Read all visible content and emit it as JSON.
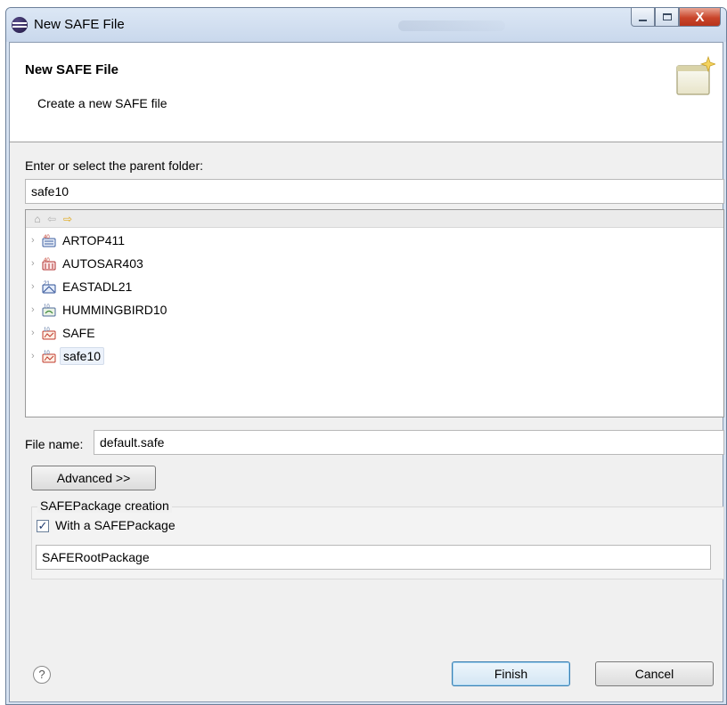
{
  "window": {
    "title": "New SAFE File",
    "controls": {
      "minimize": "minimize",
      "maximize": "maximize",
      "close": "X"
    }
  },
  "banner": {
    "title": "New SAFE File",
    "description": "Create a new SAFE file"
  },
  "parent_folder": {
    "label": "Enter or select the parent folder:",
    "value": "safe10"
  },
  "tree": {
    "toolbar": [
      "home-icon",
      "back-arrow-icon",
      "forward-arrow-icon"
    ],
    "items": [
      {
        "label": "ARTOP411",
        "icon": "artop-project-icon",
        "selected": false
      },
      {
        "label": "AUTOSAR403",
        "icon": "autosar-project-icon",
        "selected": false
      },
      {
        "label": "EASTADL21",
        "icon": "eastadl-project-icon",
        "selected": false
      },
      {
        "label": "HUMMINGBIRD10",
        "icon": "hummingbird-project-icon",
        "selected": false
      },
      {
        "label": "SAFE",
        "icon": "safe-project-icon",
        "selected": false
      },
      {
        "label": "safe10",
        "icon": "safe-project-icon",
        "selected": true
      }
    ]
  },
  "file_name": {
    "label": "File name:",
    "value": "default.safe"
  },
  "advanced_button": "Advanced >>",
  "package_group": {
    "title": "SAFEPackage creation",
    "checkbox_label": "With a SAFEPackage",
    "checked": true,
    "package_name": "SAFERootPackage"
  },
  "footer": {
    "help": "?",
    "finish": "Finish",
    "cancel": "Cancel"
  },
  "colors": {
    "title_bar": "#d6e2f1",
    "close_button": "#c9452a",
    "dialog_bg": "#f0f0f0",
    "selection": "#ecf2fb"
  }
}
